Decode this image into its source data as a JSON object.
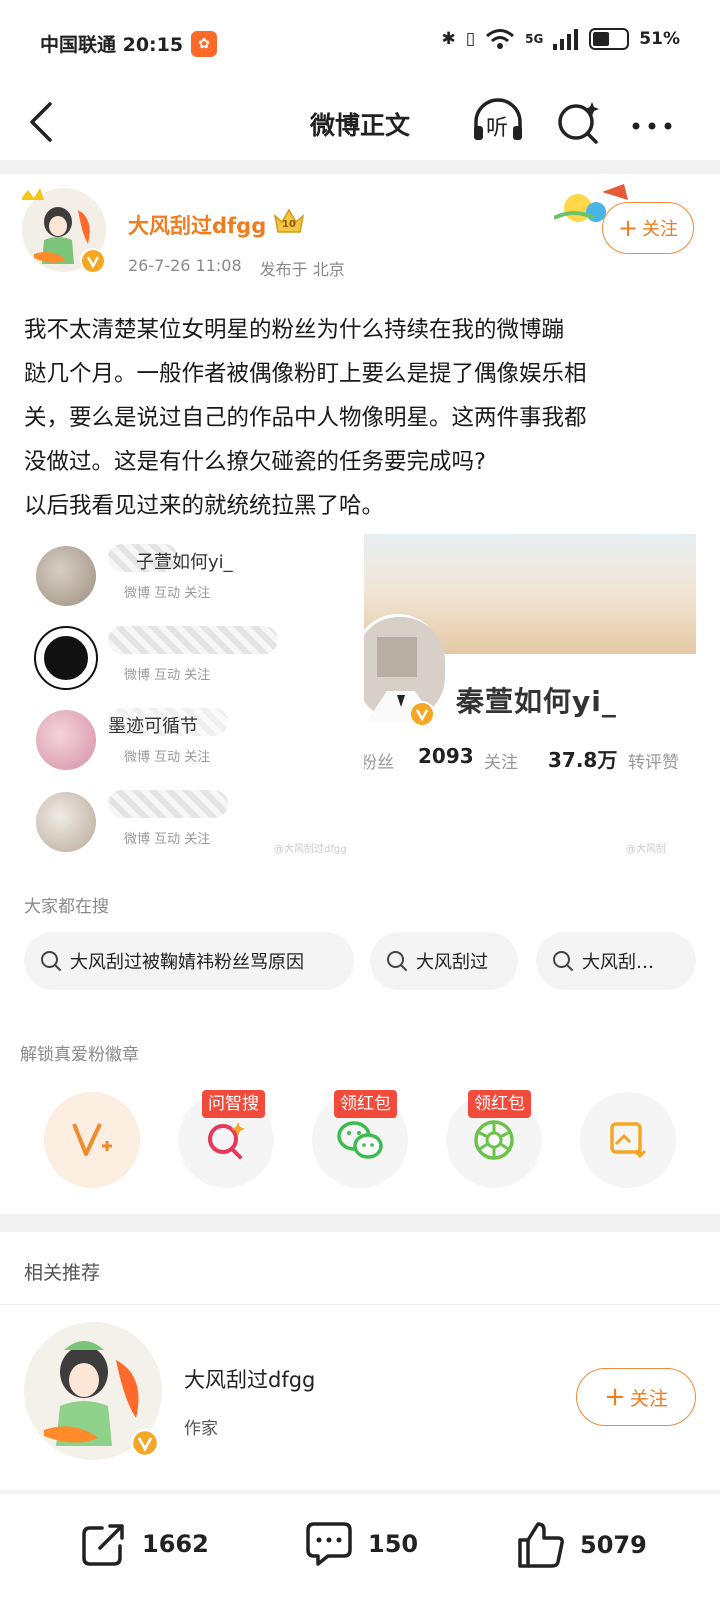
{
  "status_bar": {
    "carrier_time": "中国联通 20:15",
    "network": "5G",
    "battery": "51%",
    "battery_level": 0.51
  },
  "nav": {
    "title": "微博正文",
    "listen_label": "听"
  },
  "post": {
    "author": "大风刮过dfgg",
    "level": "10",
    "date": "26-7-26 11:08",
    "location": "发布于 北京",
    "follow_label": "关注",
    "text_lines": [
      "我不太清楚某位女明星的粉丝为什么持续在我的微博蹦",
      "跶几个月。一般作者被偶像粉盯上要么是提了偶像娱乐相",
      "关，要么是说过自己的作品中人物像明星。这两件事我都",
      "没做过。这是有什么撩欠碰瓷的任务要完成吗?",
      "以后我看见过来的就统统拉黑了哈。"
    ]
  },
  "image_left": {
    "fans": [
      {
        "name": "子萱如何yi_",
        "sub": "微博 互动 关注"
      },
      {
        "name": "",
        "sub": "微博 互动 关注"
      },
      {
        "name": "墨迹可循节",
        "sub": "微博 互动 关注"
      },
      {
        "name": "",
        "sub": "微博 互动 关注"
      }
    ],
    "watermark": "@大风刮过dfgg"
  },
  "image_right": {
    "profile_name": "秦萱如何yi_",
    "stat_fans_label": "粉丝",
    "stat_following_value": "2093",
    "stat_following_label": "关注",
    "stat_likes_value": "37.8万",
    "stat_likes_label": "转评赞",
    "watermark": "@大风刮"
  },
  "search": {
    "heading": "大家都在搜",
    "pills": [
      "大风刮过被鞠婧祎粉丝骂原因",
      "大风刮过",
      "大风刮…"
    ]
  },
  "badges": {
    "heading": "解锁真爱粉徽章",
    "tags": [
      "问智搜",
      "领红包",
      "领红包"
    ]
  },
  "recommend": {
    "heading": "相关推荐",
    "name": "大风刮过dfgg",
    "desc": "作家",
    "follow_label": "关注"
  },
  "bottom": {
    "repost": "1662",
    "comment": "150",
    "like": "5079"
  },
  "colors": {
    "accent": "#f07c1e",
    "tag_red": "#f24a3b"
  }
}
